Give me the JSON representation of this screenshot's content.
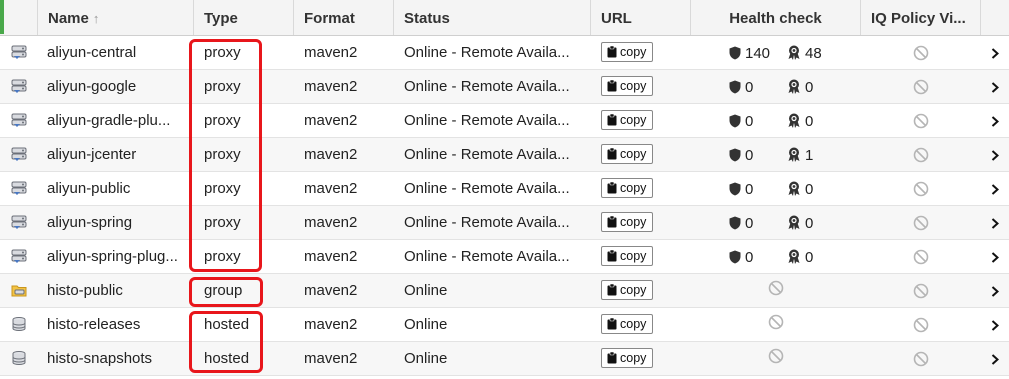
{
  "columns": {
    "name": "Name",
    "sort_arrow": "↑",
    "type": "Type",
    "format": "Format",
    "status": "Status",
    "url": "URL",
    "health": "Health check",
    "iq": "IQ Policy Vi..."
  },
  "copy_label": "copy",
  "colors": {
    "highlight": "#e8161b",
    "header_bar": "#49a84a"
  },
  "rows": [
    {
      "name": "aliyun-central",
      "type": "proxy",
      "format": "maven2",
      "status": "Online - Remote Availa...",
      "icon": "proxy-repo-icon",
      "health": {
        "security": "140",
        "license": "48"
      }
    },
    {
      "name": "aliyun-google",
      "type": "proxy",
      "format": "maven2",
      "status": "Online - Remote Availa...",
      "icon": "proxy-repo-icon",
      "health": {
        "security": "0",
        "license": "0"
      }
    },
    {
      "name": "aliyun-gradle-plu...",
      "type": "proxy",
      "format": "maven2",
      "status": "Online - Remote Availa...",
      "icon": "proxy-repo-icon",
      "health": {
        "security": "0",
        "license": "0"
      }
    },
    {
      "name": "aliyun-jcenter",
      "type": "proxy",
      "format": "maven2",
      "status": "Online - Remote Availa...",
      "icon": "proxy-repo-icon",
      "health": {
        "security": "0",
        "license": "1"
      }
    },
    {
      "name": "aliyun-public",
      "type": "proxy",
      "format": "maven2",
      "status": "Online - Remote Availa...",
      "icon": "proxy-repo-icon",
      "health": {
        "security": "0",
        "license": "0"
      }
    },
    {
      "name": "aliyun-spring",
      "type": "proxy",
      "format": "maven2",
      "status": "Online - Remote Availa...",
      "icon": "proxy-repo-icon",
      "health": {
        "security": "0",
        "license": "0"
      }
    },
    {
      "name": "aliyun-spring-plug...",
      "type": "proxy",
      "format": "maven2",
      "status": "Online - Remote Availa...",
      "icon": "proxy-repo-icon",
      "health": {
        "security": "0",
        "license": "0"
      }
    },
    {
      "name": "histo-public",
      "type": "group",
      "format": "maven2",
      "status": "Online",
      "icon": "group-repo-icon",
      "health": null
    },
    {
      "name": "histo-releases",
      "type": "hosted",
      "format": "maven2",
      "status": "Online",
      "icon": "hosted-repo-icon",
      "health": null
    },
    {
      "name": "histo-snapshots",
      "type": "hosted",
      "format": "maven2",
      "status": "Online",
      "icon": "hosted-repo-icon",
      "health": null
    }
  ]
}
